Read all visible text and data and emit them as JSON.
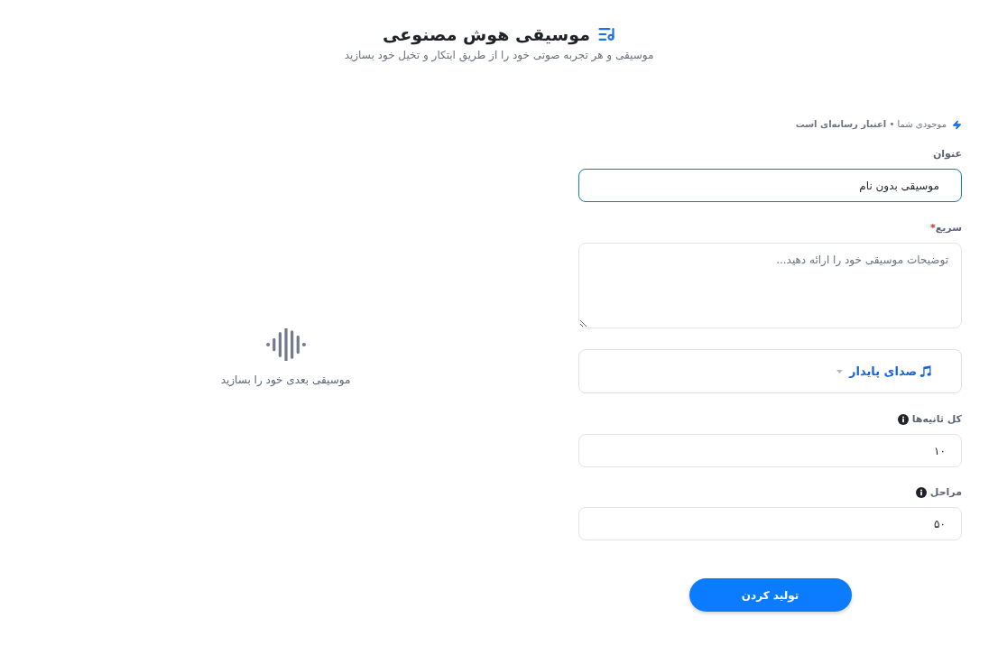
{
  "header": {
    "title": "موسیقی هوش مصنوعی",
    "subtitle": "موسیقی و هر تجربه صوتی خود را از طریق ابتکار و تخیل خود بسازید"
  },
  "empty_state": {
    "message": "موسیقی بعدی خود را بسازید"
  },
  "form": {
    "credit_note": "موجودی شما • **اعتبار رسانه‌ای است**",
    "fields": [
      {
        "kind": "text",
        "label": "عنوان",
        "value": "موسیقی بدون نام",
        "focused": true
      },
      {
        "kind": "textarea",
        "label": "سریع",
        "required_mark": "*",
        "placeholder": "توضیحات موسیقی خود را ارائه دهید...",
        "focused": false
      },
      {
        "kind": "select",
        "value": "صدای پایدار"
      },
      {
        "kind": "number",
        "label": "کل ثانیه‌ها",
        "info": true,
        "value": "۱۰",
        "focused": false
      },
      {
        "kind": "number",
        "label": "مراحل",
        "info": true,
        "value": "۵۰",
        "focused": false
      }
    ],
    "submit": "تولید کردن"
  }
}
